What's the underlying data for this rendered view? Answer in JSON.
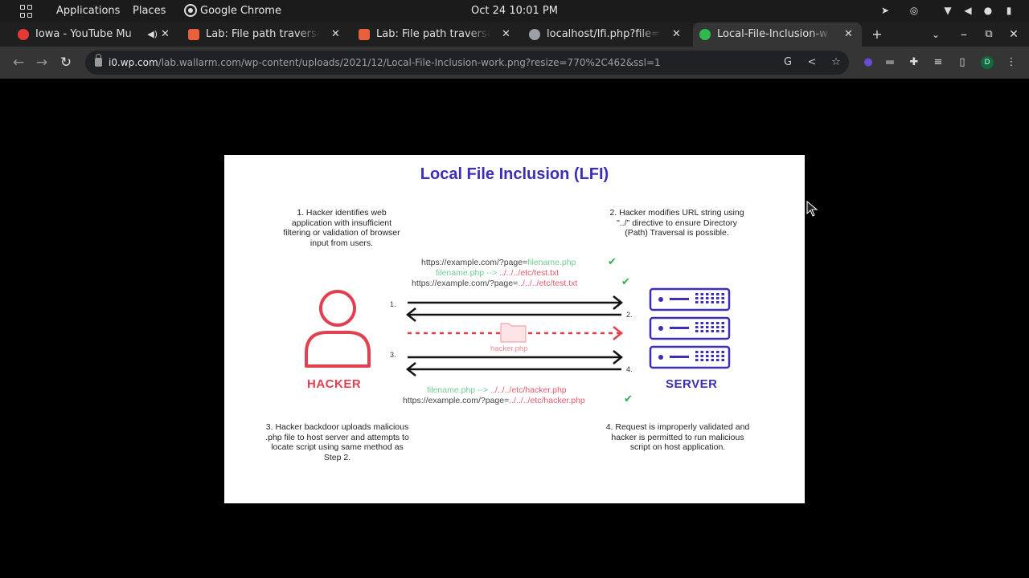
{
  "system_bar": {
    "applications_label": "Applications",
    "places_label": "Places",
    "browser_label": "Google Chrome",
    "clock": "Oct 24  10:01 PM"
  },
  "tabs": [
    {
      "title": "Iowa - YouTube Mu",
      "favicon_color": "#e53935",
      "audio": true
    },
    {
      "title": "Lab: File path traversal",
      "favicon_color": "#e8613c"
    },
    {
      "title": "Lab: File path traversal",
      "favicon_color": "#e8613c"
    },
    {
      "title": "localhost/lfi.php?file=",
      "favicon_color": "#9aa0a6"
    },
    {
      "title": "Local-File-Inclusion-w",
      "favicon_color": "#30b94d",
      "active": true
    }
  ],
  "toolbar": {
    "url_host": "i0.wp.com",
    "url_path": "/lab.wallarm.com/wp-content/uploads/2021/12/Local-File-Inclusion-work.png?resize=770%2C462&ssl=1",
    "profile_initial": "D"
  },
  "diagram": {
    "title": "Local File Inclusion (LFI)",
    "accent_color": "#3b2fb7",
    "hacker_color": "#e1404f",
    "server_color": "#3b2fb7",
    "step1": "1. Hacker identifies web application with insufficient filtering or validation of browser input from users.",
    "step2": "2. Hacker modifies URL string using \"../\" directive to ensure Directory (Path) Traversal is possible.",
    "step3": "3. Hacker backdoor uploads malicious .php file to host server and attempts to locate script using same method as Step 2.",
    "step4": "4. Request is improperly validated and hacker is permitted to run malicious script on host application.",
    "url1_base": "https://example.com/?page=",
    "url1_param": "filename.php",
    "map1_from": "filename.php -->",
    "map1_to": "../../../etc/test.txt",
    "url2_base": "https://example.com/?page=",
    "url2_param": "../../../etc/test.txt",
    "map2_from": "filename.php -->",
    "map2_to": "../../../etc/hacker.php",
    "url3_base": "https://example.com/?page=",
    "url3_param": "../../../etc/hacker.php",
    "hacker_label": "HACKER",
    "server_label": "SERVER",
    "file_label": "hacker.php",
    "arrow_numbers": [
      "1.",
      "2.",
      "3.",
      "4."
    ]
  }
}
